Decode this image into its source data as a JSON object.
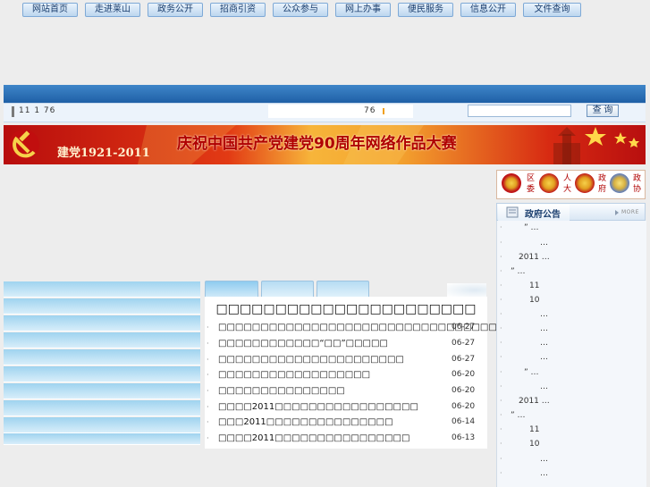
{
  "nav": {
    "items": [
      "网站首页",
      "走进莱山",
      "政务公开",
      "招商引资",
      "公众参与",
      "网上办事",
      "便民服务",
      "信息公开",
      "文件查询"
    ]
  },
  "infobar": {
    "left_text": "11 1 76",
    "center_num": "76"
  },
  "search": {
    "input_value": "",
    "button_label": "查 询"
  },
  "banner": {
    "left_text": "建党1921-2011",
    "headline": "庆祝中国共产党建党90周年网络作品大赛"
  },
  "orgs": [
    {
      "label": "区\n委"
    },
    {
      "label": "人\n大"
    },
    {
      "label": "政\n府"
    },
    {
      "label": "政\n协"
    }
  ],
  "notice": {
    "title": "政府公告",
    "more": "MORE",
    "items": [
      {
        "text": "” …"
      },
      {
        "text": "…"
      },
      {
        "text": "2011   …"
      },
      {
        "text": "” …"
      },
      {
        "text": "11"
      },
      {
        "text": "10"
      },
      {
        "text": "…"
      },
      {
        "text": "…"
      },
      {
        "text": "…"
      },
      {
        "text": "…"
      },
      {
        "text": "” …"
      },
      {
        "text": "…"
      },
      {
        "text": "2011   …"
      },
      {
        "text": "” …"
      },
      {
        "text": "11"
      },
      {
        "text": "10"
      },
      {
        "text": "…"
      },
      {
        "text": "…"
      }
    ]
  },
  "center": {
    "headline": "□□□□□□□□□□□□□□□□□□□□□□",
    "news": [
      {
        "title": "□□□□□□□□□□□□□□□□□□□□□□□□□□□□□□□□□",
        "date": "06-27"
      },
      {
        "title": "□□□□□□□□□□□□“□□”□□□□□",
        "date": "06-27"
      },
      {
        "title": "□□□□□□□□□□□□□□□□□□□□□□",
        "date": "06-27"
      },
      {
        "title": "□□□□□□□□□□□□□□□□□□",
        "date": "06-20"
      },
      {
        "title": "□□□□□□□□□□□□□□□",
        "date": "06-20"
      },
      {
        "title": "□□□□2011□□□□□□□□□□□□□□□□□",
        "date": "06-20"
      },
      {
        "title": "□□□2011□□□□□□□□□□□□□□□",
        "date": "06-14"
      },
      {
        "title": "□□□□2011□□□□□□□□□□□□□□□□",
        "date": "06-13"
      }
    ]
  },
  "colors": {
    "nav_bg": "#2a6db3",
    "banner_red": "#c0150f",
    "headline_red": "#b00000",
    "left_bar": "#b8e0f5"
  }
}
